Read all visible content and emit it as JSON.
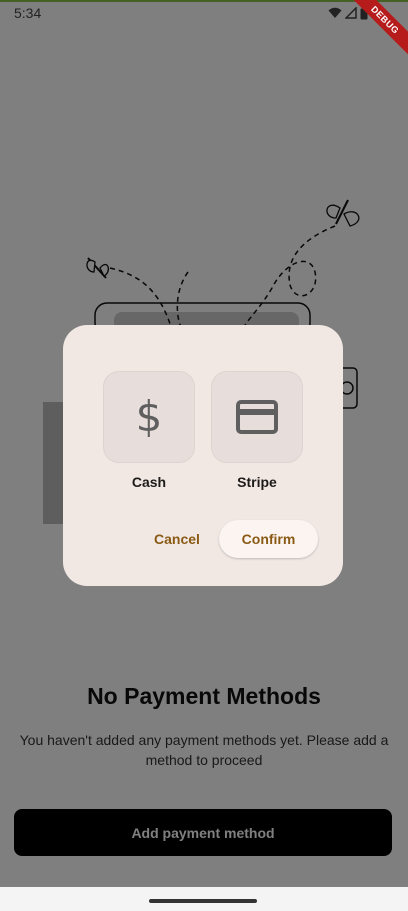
{
  "status_bar": {
    "time": "5:34",
    "debug_label": "DEBUG"
  },
  "empty_state": {
    "title": "No Payment Methods",
    "description": "You haven't added any payment methods yet. Please add a method to proceed",
    "add_button_label": "Add payment method"
  },
  "dialog": {
    "options": [
      {
        "label": "Cash",
        "icon": "dollar-icon",
        "glyph": "$"
      },
      {
        "label": "Stripe",
        "icon": "credit-card-icon"
      }
    ],
    "cancel_label": "Cancel",
    "confirm_label": "Confirm"
  },
  "colors": {
    "dialog_background": "#f1e8e4",
    "action_text": "#8a5a14",
    "primary_button": "#000000",
    "scrim": "rgba(0,0,0,0.5)"
  }
}
